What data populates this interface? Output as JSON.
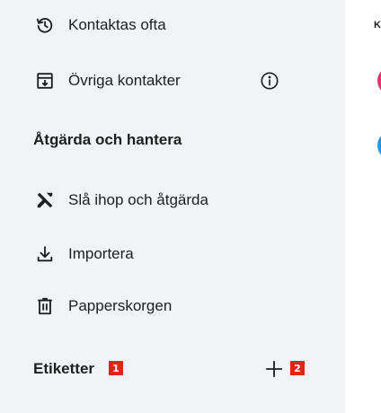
{
  "sidebar": {
    "items": [
      {
        "label": "Kontaktas ofta",
        "icon": "history-icon"
      },
      {
        "label": "Övriga kontakter",
        "icon": "archive-download-icon",
        "trailing_icon": "info-icon"
      }
    ],
    "sections": [
      {
        "title": "Åtgärda och hantera",
        "items": [
          {
            "label": "Slå ihop och åtgärda",
            "icon": "build-tools-icon"
          },
          {
            "label": "Importera",
            "icon": "download-icon"
          },
          {
            "label": "Papperskorgen",
            "icon": "trash-icon"
          }
        ]
      }
    ],
    "labels_header": {
      "title": "Etiketter",
      "add_icon": "plus-icon",
      "marker_1": "1",
      "marker_2": "2"
    }
  },
  "main": {
    "header_fragment": "K",
    "avatars": [
      {
        "color": "#e8336d"
      },
      {
        "color": "#1a9be8"
      }
    ]
  }
}
